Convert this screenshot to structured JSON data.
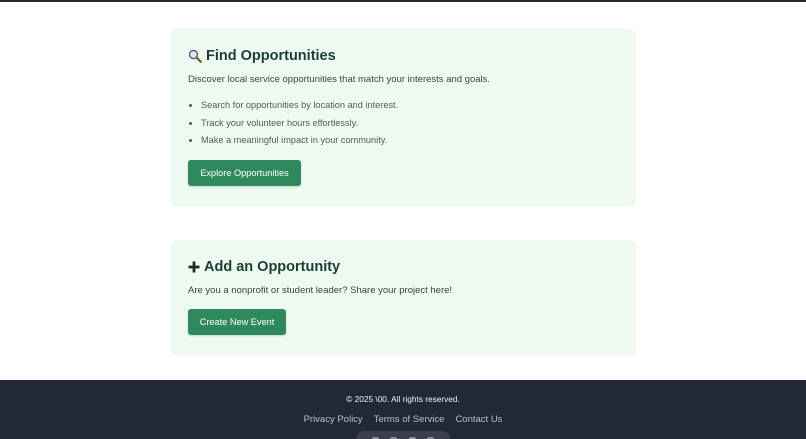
{
  "find_card": {
    "title": "Find Opportunities",
    "icon": "magnifying-glass-icon",
    "description": "Discover local service opportunities that match your interests and goals.",
    "bullets": [
      "Search for opportunities by location and interest.",
      "Track your volunteer hours effortlessly.",
      "Make a meaningful impact in your community."
    ],
    "button_label": "Explore Opportunities"
  },
  "add_card": {
    "title": "Add an Opportunity",
    "icon": "plus-icon",
    "description": "Are you a nonprofit or student leader? Share your project here!",
    "button_label": "Create New Event"
  },
  "footer": {
    "copyright": "© 2025 \\00. All rights reserved.",
    "links": [
      "Privacy Policy",
      "Terms of Service",
      "Contact Us"
    ]
  },
  "colors": {
    "card_bg": "#eefaf1",
    "button_bg": "#2e8a5c",
    "title_text": "#1e3d33",
    "footer_bg": "#222836"
  }
}
